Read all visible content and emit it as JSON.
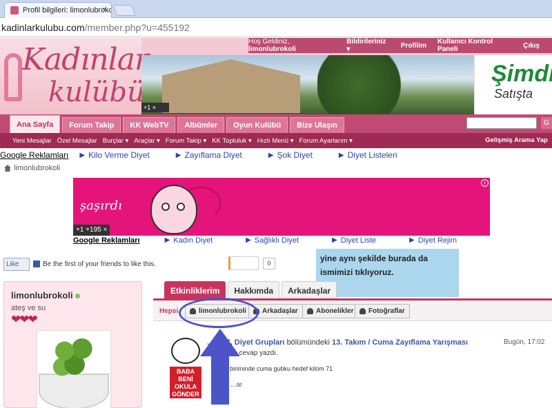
{
  "browser": {
    "tab_title": "Profil bilgileri: limonlubrokoli",
    "tab_close": "×",
    "url_host": "kadinlarkulubu.com",
    "url_rest": "/member.php?u=455192"
  },
  "header": {
    "logo_line1": "Kadınlar",
    "logo_line2": "kulübü",
    "gplus_badge": "+1  ×",
    "ad_line1": "Şimdi",
    "ad_line2": "Satışta",
    "topnav": {
      "greeting": "Hoş Geldiniz,",
      "username": "limonlubrokoli",
      "notifications": "Bildirileriniz ▾",
      "profile": "Profilim",
      "control_panel": "Kullanıcı Kontrol Paneli",
      "logout": "Çıkış"
    }
  },
  "main_tabs": [
    "Ana Sayfa",
    "Forum Takip",
    "KK WebTV",
    "Albümler",
    "Oyun Kulübü",
    "Bize Ulaşın"
  ],
  "search_go": "G",
  "subnav": [
    "Yeni Mesajlar",
    "Özel Mesajlar",
    "Burçlar ▾",
    "Araçlar ▾",
    "Forum Takip ▾",
    "KK Topluluk ▾",
    "Hızlı Menü ▾",
    "Forum Ayarlarım ▾"
  ],
  "advanced_search": "Gelişmiş Arama Yap",
  "ad_links_top": {
    "title": "Google Reklamları",
    "items": [
      "Kilo Verme Diyet",
      "Zayıflama Diyet",
      "Şok Diyet",
      "Diyet Listeleri"
    ]
  },
  "breadcrumb": "limonlubrokoli",
  "banner": {
    "text": "şaşırdı",
    "count": "+1  +195  ×",
    "info": "i"
  },
  "ad_links_bottom": {
    "title": "Google Reklamları",
    "items": [
      "Kadın Diyet",
      "Sağlıklı Diyet",
      "Diyet Liste",
      "Diyet Rejim"
    ]
  },
  "facebook": {
    "like_label": "Like",
    "text": "Be the first of your friends to like this."
  },
  "gplus_count": "0",
  "annotation_note": "yine aynı şekilde burada da ismimizi tıklıyoruz.",
  "profile": {
    "username": "limonlubrokoli",
    "motto": "ateş ve su",
    "hearts": "❤❤❤"
  },
  "profile_tabs": [
    "Etkinliklerim",
    "Hakkımda",
    "Arkadaşlar"
  ],
  "filter_buttons": {
    "all": "Hepsi",
    "user": "limonlubrokoli",
    "friends": "Arkadaşlar",
    "subscriptions": "Abonelikler",
    "photos": "Fotoğraflar"
  },
  "feed": {
    "author": "...ca87, Diyet Grupları",
    "section_text": "bölümündeki",
    "thread": "13. Takım / Cuma Zayıflama Yarışması",
    "time": "Bugün, 17:02",
    "action": "...a cevap yazdı.",
    "snippet": "...n biriminde cuma gubku hedef kilom 71",
    "more": "...ar",
    "sign_text": "BABA BENİ OKULA GÖNDER"
  },
  "colors": {
    "brand": "#c14a75",
    "annotation": "#4b55c9",
    "note_bg": "#aad6ee"
  }
}
